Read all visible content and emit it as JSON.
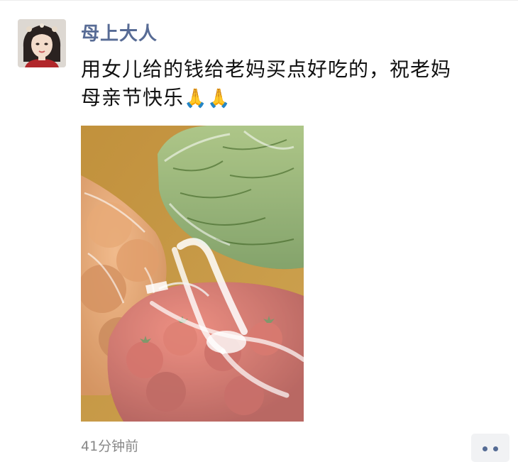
{
  "post": {
    "author": "母上大人",
    "text_line1": "用女儿给的钱给老妈买点好吃的，祝老妈",
    "text_line2": "母亲节快乐",
    "emoji": "🙏",
    "timestamp": "41分钟前"
  },
  "icons": {
    "pray": "folded-hands-emoji",
    "more": "ellipsis-icon"
  },
  "colors": {
    "author_name": "#576b95",
    "body_text": "#111111",
    "timestamp": "#888888",
    "more_button_bg": "#f1f2f4",
    "more_dots": "#556b94"
  }
}
